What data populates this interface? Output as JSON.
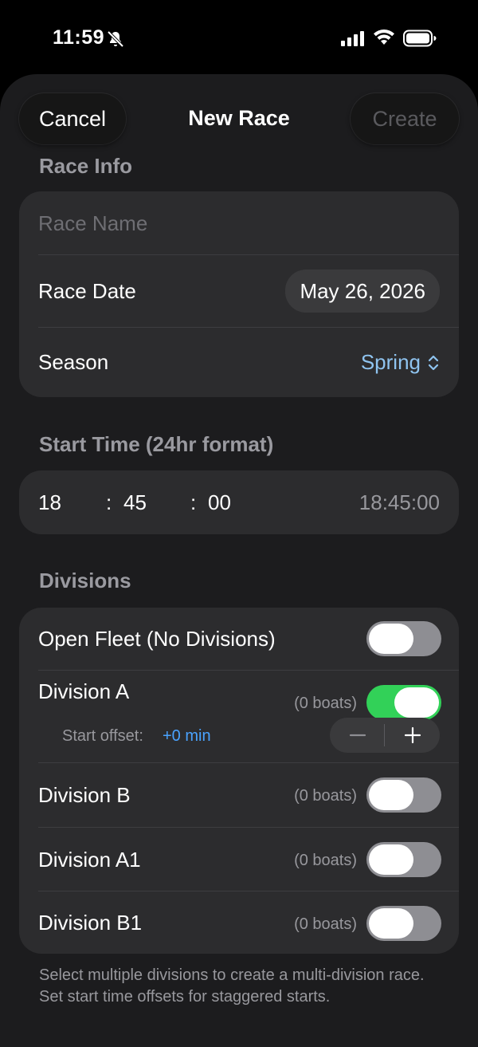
{
  "status_bar": {
    "time": "11:59",
    "icons": [
      "bell-slash-icon",
      "cellular-signal-icon",
      "wifi-icon",
      "battery-icon"
    ]
  },
  "nav": {
    "cancel_label": "Cancel",
    "title": "New Race",
    "create_label": "Create"
  },
  "race_info": {
    "header": "Race Info",
    "name_placeholder": "Race Name",
    "name_value": "",
    "date_label": "Race Date",
    "date_value": "May 26, 2026",
    "season_label": "Season",
    "season_value": "Spring"
  },
  "start_time": {
    "header": "Start Time (24hr format)",
    "hours": "18",
    "minutes": "45",
    "seconds": "00",
    "separator": ":",
    "readout": "18:45:00"
  },
  "divisions": {
    "header": "Divisions",
    "open_fleet": {
      "label": "Open Fleet (No Divisions)",
      "enabled": false
    },
    "items": [
      {
        "label": "Division A",
        "boats": "(0 boats)",
        "enabled": true,
        "offset_label": "Start offset:",
        "offset_value": "+0 min"
      },
      {
        "label": "Division B",
        "boats": "(0 boats)",
        "enabled": false
      },
      {
        "label": "Division A1",
        "boats": "(0 boats)",
        "enabled": false
      },
      {
        "label": "Division B1",
        "boats": "(0 boats)",
        "enabled": false
      }
    ],
    "footer": "Select multiple divisions to create a multi-division race. Set start time offsets for staggered starts."
  },
  "colors": {
    "background": "#1c1c1e",
    "card": "#2c2c2e",
    "accent_blue": "#4aa3ff",
    "season_blue": "#8fc4f0",
    "toggle_on": "#32d158",
    "toggle_off": "#8e8e93"
  }
}
